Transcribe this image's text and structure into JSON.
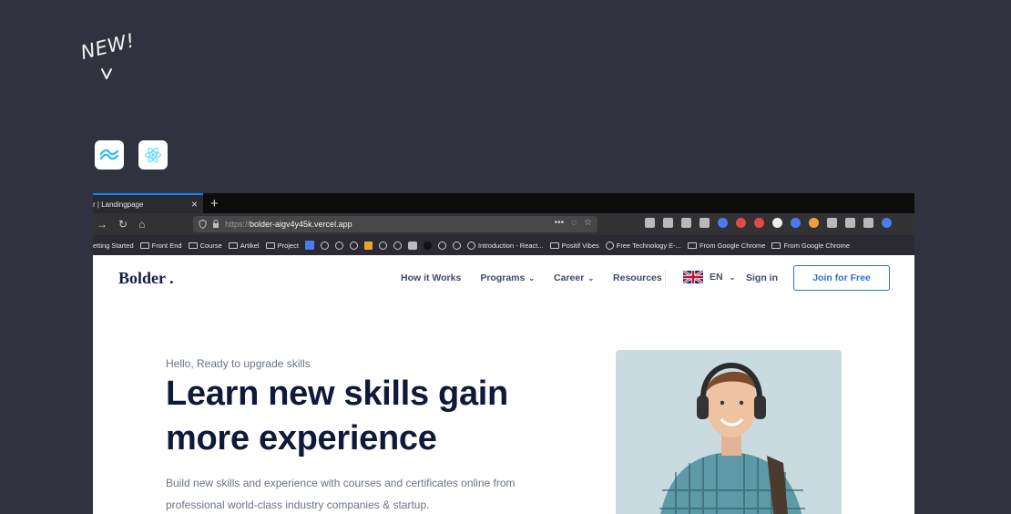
{
  "badge": {
    "text": "NEW!"
  },
  "tech_icons": [
    {
      "name": "tailwind-icon",
      "color": "#38bdf8"
    },
    {
      "name": "react-icon",
      "color": "#61dafb"
    }
  ],
  "browser": {
    "tab_title": "r | Landingpage",
    "url_protocol": "https://",
    "url_host": "bolder-aigv4y45k.vercel.app",
    "bookmarks": [
      {
        "label": "etting Started",
        "icon": "none"
      },
      {
        "label": "Front End",
        "icon": "folder"
      },
      {
        "label": "Course",
        "icon": "folder"
      },
      {
        "label": "Artikel",
        "icon": "folder"
      },
      {
        "label": "Project",
        "icon": "folder"
      },
      {
        "label": "Introduction - React...",
        "icon": "globe"
      },
      {
        "label": "Positif Vibes",
        "icon": "folder"
      },
      {
        "label": "Free Technology E-...",
        "icon": "globe"
      },
      {
        "label": "From Google Chrome",
        "icon": "folder"
      },
      {
        "label": "From Google Chrome",
        "icon": "folder"
      }
    ]
  },
  "site": {
    "logo": "Bolder .",
    "nav": [
      "How it Works",
      "Programs",
      "Career",
      "Resources"
    ],
    "lang": "EN",
    "signin": "Sign in",
    "join": "Join for Free",
    "hero": {
      "greeting": "Hello, Ready to upgrade skills",
      "headline_1": "Learn new skills gain",
      "headline_2": "more experience",
      "desc_1": "Build new skills and experience with courses and certificates online from",
      "desc_2": "professional world-class industry companies & startup."
    }
  },
  "colors": {
    "background": "#30323f",
    "brand_navy": "#0f1a3a",
    "accent_blue": "#2f6fca",
    "hero_card": "#c9dbe0"
  }
}
